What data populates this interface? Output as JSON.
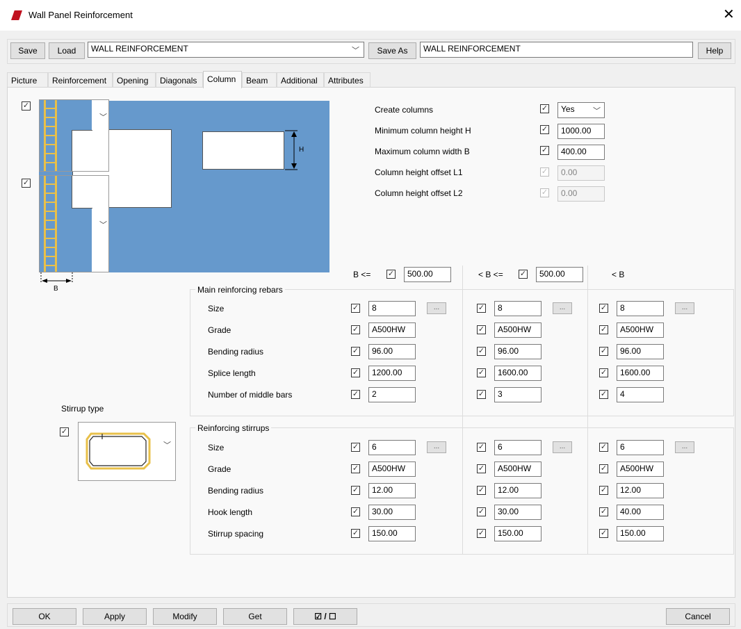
{
  "window": {
    "title": "Wall Panel Reinforcement",
    "close_glyph": "✕"
  },
  "toolbar": {
    "save": "Save",
    "load": "Load",
    "preset": "WALL REINFORCEMENT",
    "save_as": "Save As",
    "save_as_name": "WALL REINFORCEMENT",
    "help": "Help"
  },
  "tabs": [
    "Picture",
    "Reinforcement",
    "Opening",
    "Diagonals",
    "Column",
    "Beam",
    "Additional",
    "Attributes"
  ],
  "active_tab": "Column",
  "diagram": {
    "label_h": "H",
    "label_b": "B"
  },
  "settings": {
    "create_columns": {
      "label": "Create columns",
      "value": "Yes"
    },
    "min_height": {
      "label": "Minimum column height H",
      "value": "1000.00"
    },
    "max_width": {
      "label": "Maximum column width B",
      "value": "400.00"
    },
    "offset_l1": {
      "label": "Column height offset L1",
      "value": "0.00"
    },
    "offset_l2": {
      "label": "Column height offset L2",
      "value": "0.00"
    }
  },
  "columns": {
    "c1_label": "B <=",
    "c1_value": "500.00",
    "c2_label": "< B <=",
    "c2_value": "500.00",
    "c3_label": "< B"
  },
  "main_rebars": {
    "title": "Main reinforcing rebars",
    "labels": [
      "Size",
      "Grade",
      "Bending radius",
      "Splice length",
      "Number of middle bars"
    ],
    "c1": [
      "8",
      "A500HW",
      "96.00",
      "1200.00",
      "2"
    ],
    "c2": [
      "8",
      "A500HW",
      "96.00",
      "1600.00",
      "3"
    ],
    "c3": [
      "8",
      "A500HW",
      "96.00",
      "1600.00",
      "4"
    ]
  },
  "stirrups": {
    "title": "Reinforcing stirrups",
    "labels": [
      "Size",
      "Grade",
      "Bending radius",
      "Hook length",
      "Stirrup spacing"
    ],
    "c1": [
      "6",
      "A500HW",
      "12.00",
      "30.00",
      "150.00"
    ],
    "c2": [
      "6",
      "A500HW",
      "12.00",
      "30.00",
      "150.00"
    ],
    "c3": [
      "6",
      "A500HW",
      "12.00",
      "40.00",
      "150.00"
    ]
  },
  "stirrup_type": {
    "label": "Stirrup type"
  },
  "ellipsis": "...",
  "footer": {
    "ok": "OK",
    "apply": "Apply",
    "modify": "Modify",
    "get": "Get",
    "toggle": "☑ / ☐",
    "cancel": "Cancel"
  },
  "colors": {
    "diagram_blue": "#6699cc",
    "rebar_yellow": "#e8c04a"
  }
}
